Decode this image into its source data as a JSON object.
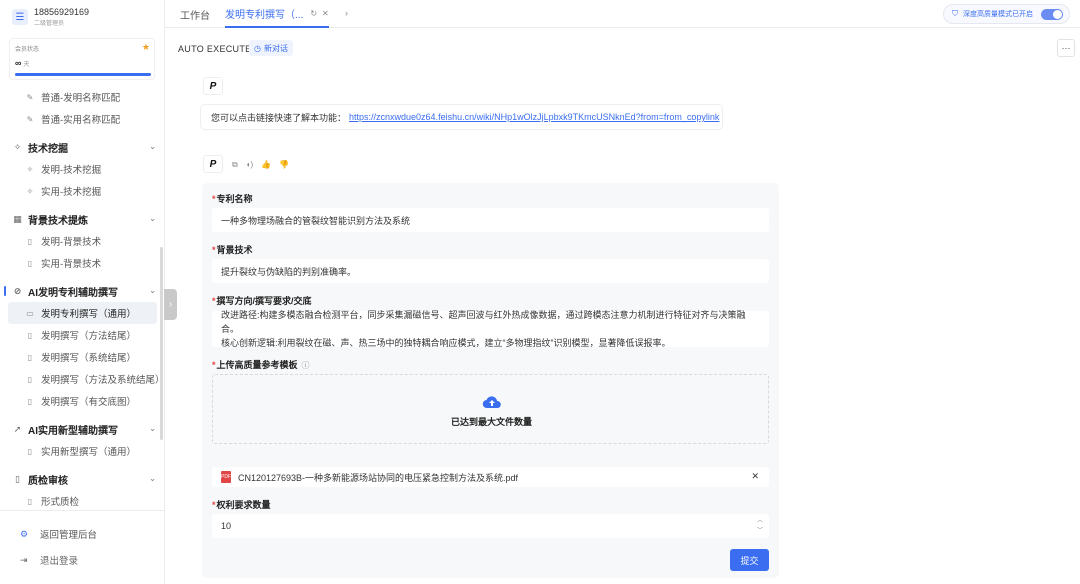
{
  "user": {
    "avatar": "☰",
    "phone": "18856929169",
    "role": "二级管理员"
  },
  "member": {
    "label": "会员状态",
    "value": "∞",
    "unit": "天",
    "progress": 1.0
  },
  "nav": {
    "top_items": [
      {
        "label": "普通-发明名称匹配",
        "icon": "pen-icon"
      },
      {
        "label": "普通-实用名称匹配",
        "icon": "pen-icon"
      }
    ],
    "sections": [
      {
        "label": "技术挖掘",
        "items": [
          "发明-技术挖掘",
          "实用-技术挖掘"
        ]
      },
      {
        "label": "背景技术提炼",
        "items": [
          "发明-背景技术",
          "实用-背景技术"
        ]
      },
      {
        "label": "AI发明专利辅助撰写",
        "items": [
          "发明专利撰写（通用）",
          "发明撰写（方法结尾）",
          "发明撰写（系统结尾）",
          "发明撰写（方法及系统结尾）",
          "发明撰写（有交底图）"
        ]
      },
      {
        "label": "AI实用新型辅助撰写",
        "items": [
          "实用新型撰写（通用）"
        ]
      },
      {
        "label": "质检审核",
        "items": [
          "形式质检"
        ]
      }
    ],
    "footer": {
      "admin": "返回管理后台",
      "logout": "退出登录"
    }
  },
  "tabs": {
    "home": "工作台",
    "active": "发明专利撰写（..."
  },
  "deep_mode": "深度高质量模式已开启",
  "header": {
    "auto_execute": "AUTO  EXECUTE",
    "new_chat": "新对话",
    "more": "···"
  },
  "bot": {
    "logo": "P"
  },
  "message1": {
    "text": "您可以点击链接快速了解本功能：",
    "link": "https://zcnxwdue0z64.feishu.cn/wiki/NHp1wOlzJjLpbxk9TKmcUSNknEd?from=from_copylink"
  },
  "form": {
    "patent_name_label": "专利名称",
    "patent_name_value": "一种多物理场融合的管裂纹智能识别方法及系统",
    "background_label": "背景技术",
    "background_value": "提升裂纹与伪缺陷的判别准确率。",
    "direction_label": "撰写方向/撰写要求/交底",
    "direction_line1": "改进路径:构建多模态融合检测平台，同步采集漏磁信号、超声回波与红外热成像数据，通过跨模态注意力机制进行特征对齐与决策融合。",
    "direction_line2": "核心创新逻辑:利用裂纹在磁、声、热三场中的独特耦合响应模式，建立“多物理指纹”识别模型，显著降低误报率。",
    "upload_label": "上传高质量参考模板",
    "upload_status": "已达到最大文件数量",
    "file_name": "CN120127693B-一种多新能源场站协同的电压紧急控制方法及系统.pdf",
    "claims_label": "权利要求数量",
    "claims_value": "10",
    "submit": "提交"
  }
}
